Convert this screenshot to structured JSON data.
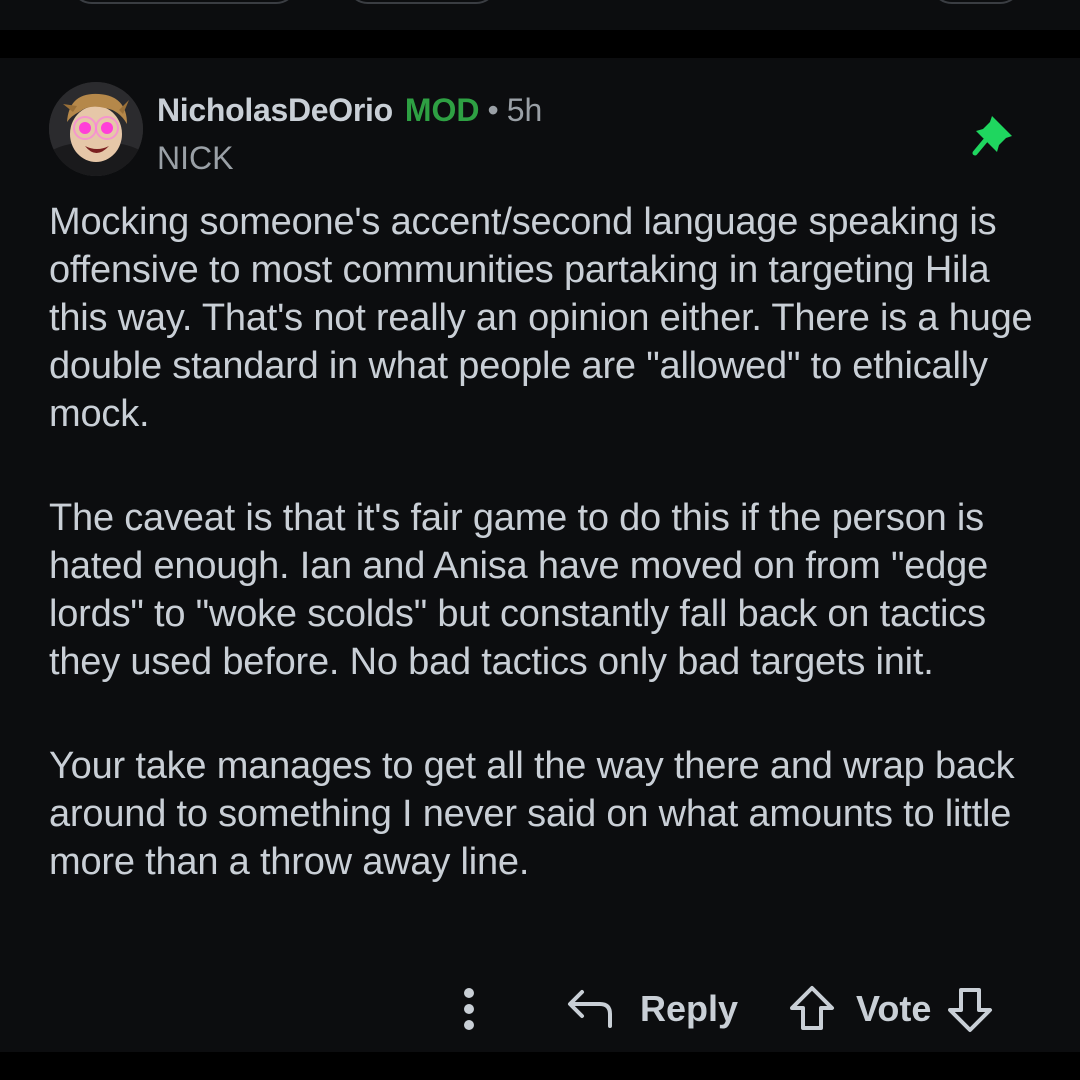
{
  "comment": {
    "username": "NicholasDeOrio",
    "mod_badge": "MOD",
    "separator": "•",
    "time": "5h",
    "flair": "NICK",
    "pin_icon": "pin-icon",
    "paragraphs": [
      "Mocking someone's accent/second language speaking is offensive to most communities partaking in targeting Hila this way. That's not really an opinion either. There is a huge double standard in what people are \"allowed\" to ethically mock.",
      "The caveat is that it's fair game to do this if the person is hated enough. Ian and Anisa have moved on from \"edge lords\" to \"woke scolds\" but constantly fall back on tactics they used before. No bad tactics only bad targets init.",
      "Your take manages to get all the way there and wrap back around to something I never said on what amounts to little more than a throw away line."
    ]
  },
  "actions": {
    "more_icon": "more-vertical-icon",
    "reply_label": "Reply",
    "vote_label": "Vote"
  },
  "colors": {
    "background": "#0c0d0f",
    "text": "#c9cfd6",
    "muted": "#9aa0a6",
    "mod_green": "#2ea043",
    "pin_green": "#1fd65f"
  }
}
